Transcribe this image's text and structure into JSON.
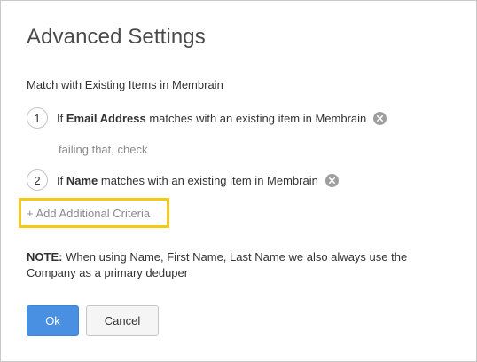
{
  "dialog": {
    "title": "Advanced Settings",
    "subtitle": "Match with Existing Items in Membrain"
  },
  "rules": [
    {
      "number": "1",
      "prefix": "If",
      "field": "Email Address",
      "suffix": "matches with an existing item in Membrain",
      "remove_icon": "close-circle-icon"
    },
    {
      "number": "2",
      "prefix": "If",
      "field": "Name",
      "suffix": "matches with an existing item in Membrain",
      "remove_icon": "close-circle-icon"
    }
  ],
  "failing_text": "failing that, check",
  "add_criteria_label": "+ Add Additional Criteria",
  "note": {
    "label": "NOTE:",
    "text": "When using Name, First Name, Last Name we also always use the Company as a primary deduper"
  },
  "buttons": {
    "ok": "Ok",
    "cancel": "Cancel"
  },
  "colors": {
    "highlight": "#f6c915",
    "primary_button": "#4a90e2",
    "remove_icon": "#9e9e9e"
  }
}
